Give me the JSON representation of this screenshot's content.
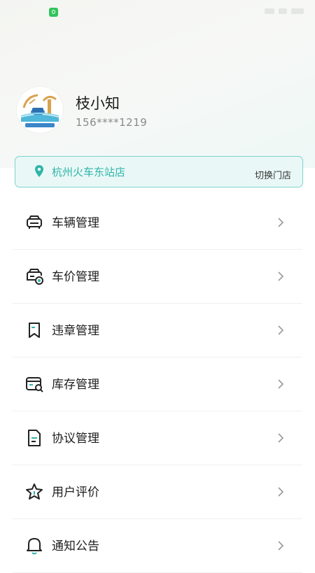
{
  "profile": {
    "name": "枝小知",
    "phone": "156****1219",
    "avatar_icon": "beach-logo-icon"
  },
  "store": {
    "name": "杭州火车东站店",
    "switch_label": "切换门店",
    "icon": "location-pin-icon"
  },
  "menu": {
    "items": [
      {
        "label": "车辆管理",
        "icon": "car-icon"
      },
      {
        "label": "车价管理",
        "icon": "car-price-icon"
      },
      {
        "label": "违章管理",
        "icon": "bookmark-icon"
      },
      {
        "label": "库存管理",
        "icon": "inventory-icon"
      },
      {
        "label": "协议管理",
        "icon": "document-icon"
      },
      {
        "label": "用户评价",
        "icon": "star-icon"
      },
      {
        "label": "通知公告",
        "icon": "bell-icon"
      }
    ]
  },
  "colors": {
    "accent": "#2fb4a9",
    "card_border": "#7fd2cd",
    "card_bg": "#e9f8f7",
    "text": "#1e1e1e",
    "muted": "#8a8a8a"
  }
}
